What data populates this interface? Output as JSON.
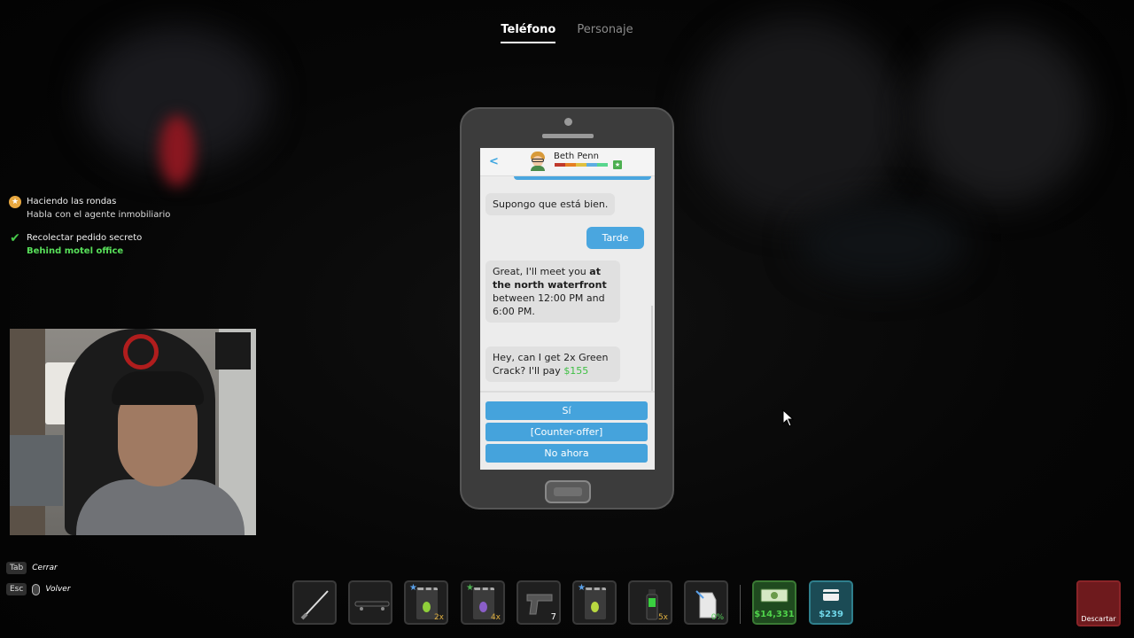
{
  "tabs": [
    {
      "label": "Teléfono",
      "active": true
    },
    {
      "label": "Personaje",
      "active": false
    }
  ],
  "objectives": [
    {
      "icon": "star-icon",
      "title": "Haciendo las rondas",
      "subtitle": "Habla con el agente inmobiliario",
      "subtitle_color": "#dcdcdc"
    },
    {
      "icon": "check-icon",
      "title": "Recolectar pedido secreto",
      "subtitle": "Behind motel office",
      "subtitle_color": "#58e05a"
    }
  ],
  "hints": [
    {
      "key": "Tab",
      "action": "Cerrar"
    },
    {
      "key": "Esc",
      "action": "Volver"
    }
  ],
  "phone": {
    "contact_name": "Beth Penn",
    "messages": {
      "m1": "Supongo que está bien.",
      "m2": "Tarde",
      "m3_a": "Great, I'll meet you ",
      "m3_b": "at the north waterfront",
      "m3_c": " between 12:00 PM and 6:00 PM.",
      "m4_a": "Hey, can I get 2x Green Crack? I'll pay ",
      "m4_price": "$155"
    },
    "responses": [
      "Sí",
      "[Counter-offer]",
      "No ahora"
    ]
  },
  "hotbar": {
    "slots": [
      {
        "icon": "baton-icon",
        "count": ""
      },
      {
        "icon": "skateboard-icon",
        "count": ""
      },
      {
        "icon": "weed-bag-icon",
        "count": "2x"
      },
      {
        "icon": "purple-bag-icon",
        "count": "4x"
      },
      {
        "icon": "pistol-icon",
        "count": "7"
      },
      {
        "icon": "weed-bag-icon",
        "count": ""
      },
      {
        "icon": "spray-bottle-icon",
        "count": "5x"
      },
      {
        "icon": "jug-icon",
        "count": "0%"
      }
    ],
    "cash": "$14,331",
    "card": "$239",
    "discard_label": "Descartar"
  },
  "colors": {
    "accent_blue": "#45a3dc",
    "cash_green": "#4fd24a",
    "card_teal": "#6fd6e8",
    "discard_red": "#6e1a1d"
  }
}
